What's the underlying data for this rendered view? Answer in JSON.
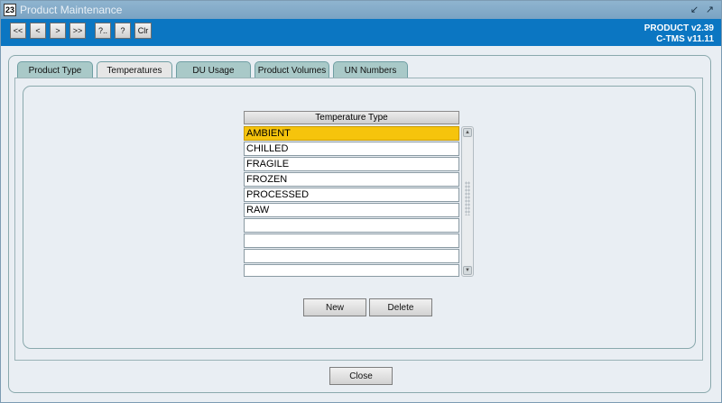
{
  "window": {
    "title": "Product Maintenance",
    "icon_text": "23"
  },
  "toolbar": {
    "buttons": [
      {
        "label": "<<",
        "icon": "first-record-icon"
      },
      {
        "label": "<",
        "icon": "previous-record-icon"
      },
      {
        "label": ">",
        "icon": "next-record-icon"
      },
      {
        "label": ">>",
        "icon": "last-record-icon"
      },
      {
        "label": "?..",
        "icon": "query-icon"
      },
      {
        "label": "?",
        "icon": "help-icon"
      },
      {
        "label": "Clr",
        "icon": "clear-icon"
      }
    ],
    "version_line1": "PRODUCT v2.39",
    "version_line2": "C-TMS v11.11"
  },
  "tabs": [
    {
      "label": "Product Type",
      "active": false
    },
    {
      "label": "Temperatures",
      "active": true
    },
    {
      "label": "DU Usage",
      "active": false
    },
    {
      "label": "Product Volumes",
      "active": false
    },
    {
      "label": "UN Numbers",
      "active": false
    }
  ],
  "grid": {
    "header": "Temperature Type",
    "rows": [
      "AMBIENT",
      "CHILLED",
      "FRAGILE",
      "FROZEN",
      "PROCESSED",
      "RAW",
      "",
      "",
      "",
      ""
    ],
    "selected_index": 0
  },
  "actions": {
    "new_label": "New",
    "delete_label": "Delete",
    "close_label": "Close"
  },
  "colors": {
    "toolbar": "#0b76c2",
    "selected_row": "#f6c40c",
    "tab_inactive": "#a9c9c8"
  }
}
